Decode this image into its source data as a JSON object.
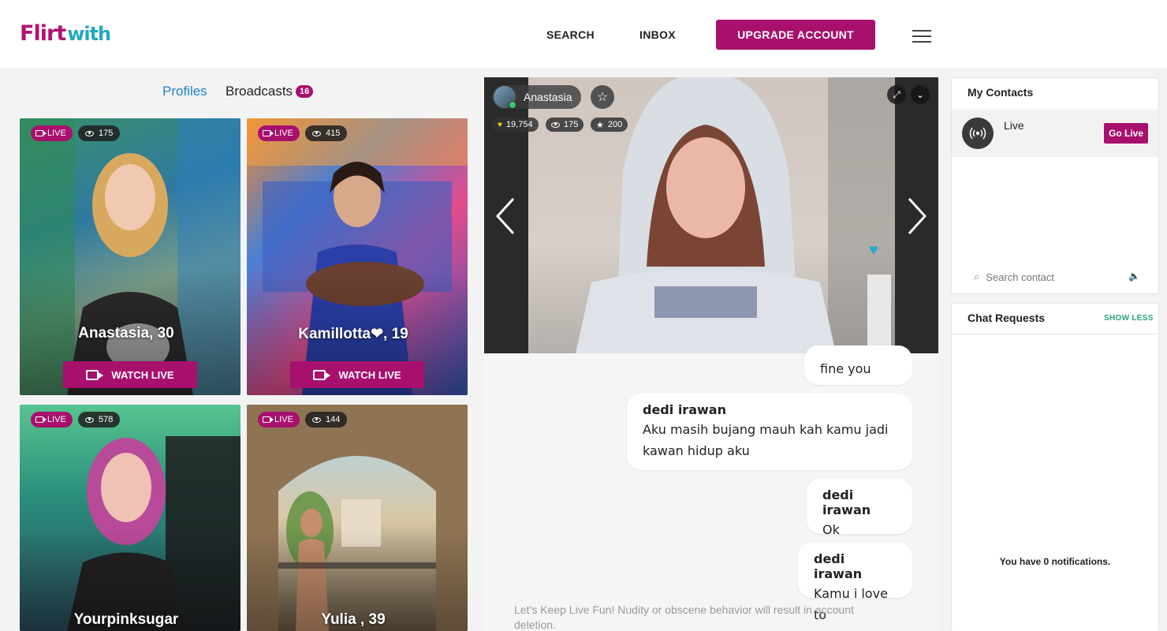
{
  "header": {
    "logo_part1": "Flirt",
    "logo_part2": "with",
    "nav_search": "SEARCH",
    "nav_inbox": "INBOX",
    "upgrade_label": "UPGRADE ACCOUNT"
  },
  "tabs": {
    "profiles": "Profiles",
    "broadcasts": "Broadcasts",
    "broadcasts_count": "16"
  },
  "cards": [
    {
      "live": "LIVE",
      "viewers": "175",
      "name": "Anastasia, 30",
      "watch": "WATCH LIVE"
    },
    {
      "live": "LIVE",
      "viewers": "415",
      "name": "Kamillotta❤, 19",
      "watch": "WATCH LIVE"
    },
    {
      "live": "LIVE",
      "viewers": "578",
      "name": "Yourpinksugar"
    },
    {
      "live": "LIVE",
      "viewers": "144",
      "name": "Yulia , 39"
    }
  ],
  "stream": {
    "username": "Anastasia",
    "likes": "19,754",
    "viewers": "175",
    "stars": "200"
  },
  "chat": [
    {
      "text": "fine you"
    },
    {
      "who": "dedi irawan",
      "text": "Aku masih bujang mauh kah kamu jadi kawan hidup aku"
    },
    {
      "who": "dedi irawan",
      "text": "Ok"
    },
    {
      "who": "dedi irawan",
      "text": "Kamu i love to"
    }
  ],
  "disclaimer": "Let’s Keep Live Fun! Nudity or obscene behavior will result in account deletion.",
  "contacts": {
    "title": "My Contacts",
    "live_label": "Live",
    "go_live": "Go Live",
    "search_placeholder": "Search contact"
  },
  "requests": {
    "title": "Chat Requests",
    "show_less": "SHOW LESS",
    "notif_prefix": "You have ",
    "notif_count": "0",
    "notif_suffix": " notifications."
  },
  "colors": {
    "brand": "#a8106d",
    "accent": "#23a8bd",
    "tab_active": "#1c86c6"
  }
}
